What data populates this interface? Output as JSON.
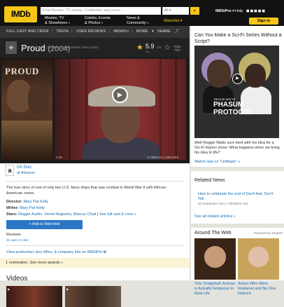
{
  "header": {
    "logo": "IMDb",
    "search_placeholder": "Find Movies, TV shows, Celebrities and more...",
    "search_category": "All",
    "menus": [
      {
        "line1": "Movies, TV",
        "line2": "& Showtimes"
      },
      {
        "line1": "Celebs, Events",
        "line2": "& Photos"
      },
      {
        "line1": "News &",
        "line2": "Community"
      }
    ],
    "watchlist": "Watchlist",
    "imdbpro": "IMDbPro",
    "help": "Help",
    "signin": "Sign in"
  },
  "subnav": {
    "items": [
      "FULL CAST AND CREW",
      "TRIVIA",
      "USER REVIEWS",
      "IMDbPro",
      "MORE"
    ],
    "share": "SHARE"
  },
  "title": {
    "name": "Proud",
    "year": "(2004)",
    "rating_cert": "PG",
    "runtime": "1h 37min",
    "genre": "Drama",
    "release": "11 November 2004 (USA)",
    "rating": "5.9",
    "rating_of": "/10",
    "rating_count": "101",
    "rate_label_1": "Rate",
    "rate_label_2": "This"
  },
  "media": {
    "poster_title": "PROUD",
    "video_duration": "1:40",
    "video_counts": "3 VIDEOS  |  2 IMAGES"
  },
  "ondisc": {
    "label": "On Disc",
    "link": "at Amazon"
  },
  "details": {
    "plot": "The true story of one of only two U.S. Navy ships that saw combat in World War II with African-American crews.",
    "director_label": "Director:",
    "director": "Mary Pat Kelly",
    "writer_label": "Writer:",
    "writer": "Mary Pat Kelly",
    "stars_label": "Stars:",
    "stars": "Reggie Austin, Vernel Bagneris, Marcus Chait",
    "full_cast_link": "See full cast & crew »",
    "add_watchlist": "+ Add to Watchlist",
    "reviews_label": "Reviews",
    "reviews_link": "31 user  |  3 critic",
    "view_production": "View production, box office, & company info on IMDbPro",
    "nominations": "1 nomination. See more awards »",
    "videos_title": "Videos"
  },
  "sidebar": {
    "ad_title": "Can You Make a Sci-Fi Series Without a Script?",
    "ad_small": "REGGIE WATTS'",
    "ad_big1": "PHASUM",
    "ad_big2": "PROTOCOL",
    "ad_text": "Well Reggie Watts sure tried with his idea for a Sci-Fi improv show. What happens when we bring his idea to life?",
    "ad_link": "Watch now on \"UnMade\" »",
    "news_title": "Related News",
    "news_item": "How to celebrate the end of Don't Ask, Don't Tell",
    "news_meta": "20 September 2011  |  AfterElton.com",
    "news_all": "See all related articles »",
    "web_title": "Around The Web",
    "web_powered": "Powered by ZergNet",
    "web_items": [
      "This 'Dodgeball' Actress is Actually Gorgeous in Real Life",
      "Actors Who Were Replaced and No One Noticed"
    ]
  }
}
